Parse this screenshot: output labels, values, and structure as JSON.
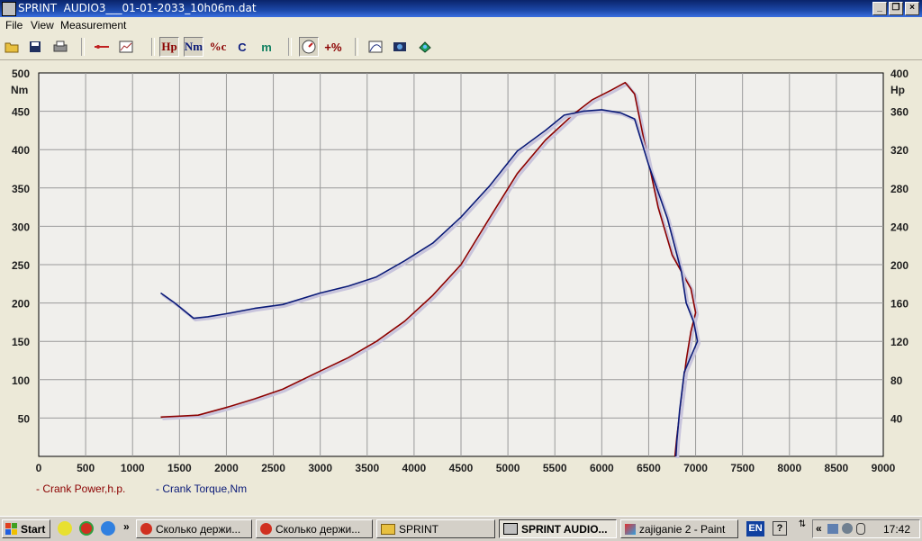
{
  "window": {
    "title": "SPRINT  AUDIO3___01-01-2033_10h06m.dat",
    "min": "_",
    "restore": "❐",
    "close": "×"
  },
  "menu": [
    "File",
    "View",
    "Measurement"
  ],
  "toolbar": {
    "hp": "Hp",
    "nm": "Nm",
    "pct": "%c",
    "c": "C",
    "m": "m",
    "plus_pct": "+%"
  },
  "chart_data": {
    "type": "line",
    "xlim": [
      0,
      9000
    ],
    "x_ticks": [
      "0",
      "500",
      "1000",
      "1500",
      "2000",
      "2500",
      "3000",
      "3500",
      "4000",
      "4500",
      "5000",
      "5500",
      "6000",
      "6500",
      "7000",
      "7500",
      "8000",
      "8500",
      "9000"
    ],
    "y_left": {
      "unit": "Nm",
      "lim": [
        0,
        500
      ],
      "ticks": [
        "50",
        "100",
        "150",
        "200",
        "250",
        "300",
        "350",
        "400",
        "450",
        "500"
      ]
    },
    "y_right": {
      "unit": "Hp",
      "lim": [
        0,
        400
      ],
      "ticks": [
        "40",
        "80",
        "120",
        "160",
        "200",
        "240",
        "280",
        "320",
        "360",
        "400"
      ]
    },
    "grid": true,
    "legend_position": "bottom-left",
    "series": [
      {
        "name": "- Crank Power,h.p.",
        "axis": "right",
        "color": "#8b0000",
        "points": [
          [
            1300,
            41
          ],
          [
            1500,
            42
          ],
          [
            1700,
            43
          ],
          [
            2000,
            51
          ],
          [
            2300,
            60
          ],
          [
            2600,
            70
          ],
          [
            3000,
            89
          ],
          [
            3300,
            103
          ],
          [
            3600,
            120
          ],
          [
            3900,
            141
          ],
          [
            4200,
            168
          ],
          [
            4500,
            200
          ],
          [
            4800,
            248
          ],
          [
            5100,
            295
          ],
          [
            5400,
            330
          ],
          [
            5700,
            357
          ],
          [
            5900,
            372
          ],
          [
            6100,
            382
          ],
          [
            6250,
            390
          ],
          [
            6350,
            378
          ],
          [
            6450,
            330
          ],
          [
            6600,
            260
          ],
          [
            6750,
            210
          ],
          [
            6950,
            175
          ],
          [
            7000,
            150
          ],
          [
            6950,
            130
          ],
          [
            6900,
            100
          ],
          [
            6850,
            60
          ],
          [
            6800,
            20
          ],
          [
            6780,
            0
          ]
        ]
      },
      {
        "name": "- Crank Torque,Nm",
        "axis": "left",
        "color": "#0a1a78",
        "points": [
          [
            1300,
            213
          ],
          [
            1450,
            200
          ],
          [
            1650,
            180
          ],
          [
            1800,
            182
          ],
          [
            2000,
            186
          ],
          [
            2300,
            193
          ],
          [
            2600,
            198
          ],
          [
            3000,
            213
          ],
          [
            3300,
            222
          ],
          [
            3600,
            234
          ],
          [
            3900,
            255
          ],
          [
            4200,
            278
          ],
          [
            4500,
            312
          ],
          [
            4800,
            352
          ],
          [
            5100,
            398
          ],
          [
            5400,
            425
          ],
          [
            5600,
            445
          ],
          [
            5800,
            450
          ],
          [
            6000,
            452
          ],
          [
            6200,
            448
          ],
          [
            6350,
            440
          ],
          [
            6500,
            380
          ],
          [
            6700,
            310
          ],
          [
            6850,
            240
          ],
          [
            6900,
            200
          ],
          [
            6980,
            175
          ],
          [
            7020,
            150
          ],
          [
            6950,
            130
          ],
          [
            6880,
            110
          ],
          [
            6830,
            60
          ],
          [
            6800,
            20
          ],
          [
            6790,
            0
          ]
        ]
      }
    ]
  },
  "legend": {
    "power": "- Crank Power,h.p.",
    "torque": "- Crank Torque,Nm"
  },
  "taskbar": {
    "start": "Start",
    "tasks": [
      "Сколько держи...",
      "Сколько держи...",
      "SPRINT",
      "SPRINT  AUDIO...",
      "zajiganie 2 - Paint"
    ],
    "lang": "EN",
    "clock": "17:42"
  }
}
